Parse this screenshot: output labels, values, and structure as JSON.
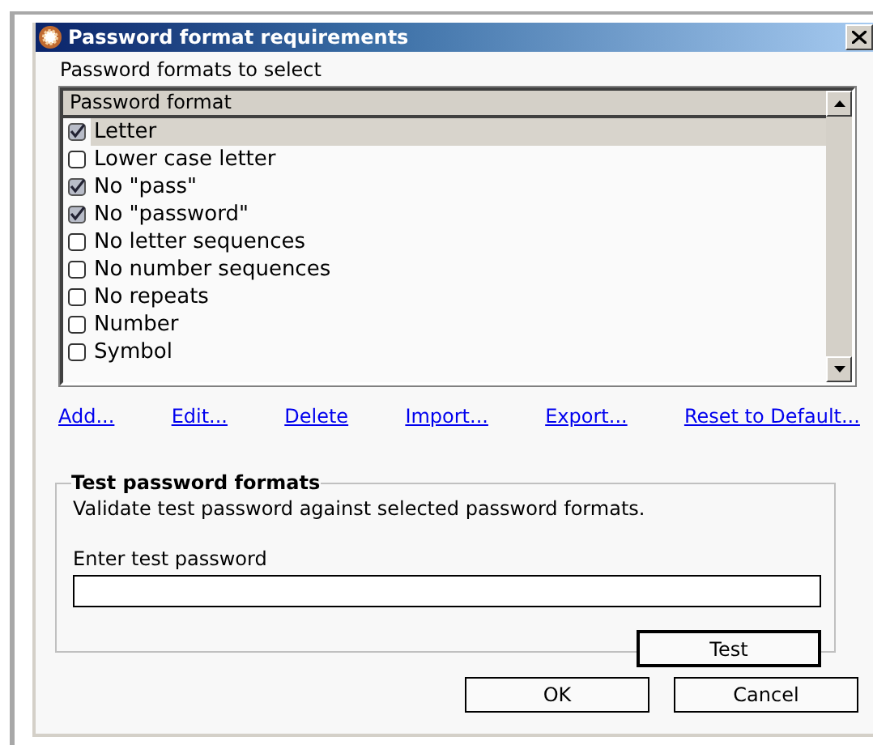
{
  "window": {
    "title": "Password format requirements"
  },
  "list_label": "Password formats to select",
  "table": {
    "columns": [
      "Password format"
    ],
    "rows": [
      {
        "label": "Letter",
        "checked": true,
        "selected": true
      },
      {
        "label": "Lower case letter",
        "checked": false,
        "selected": false
      },
      {
        "label": "No \"pass\"",
        "checked": true,
        "selected": false
      },
      {
        "label": "No \"password\"",
        "checked": true,
        "selected": false
      },
      {
        "label": "No letter sequences",
        "checked": false,
        "selected": false
      },
      {
        "label": "No number sequences",
        "checked": false,
        "selected": false
      },
      {
        "label": "No repeats",
        "checked": false,
        "selected": false
      },
      {
        "label": "Number",
        "checked": false,
        "selected": false
      },
      {
        "label": "Symbol",
        "checked": false,
        "selected": false
      }
    ]
  },
  "links": [
    "Add...",
    "Edit...",
    "Delete",
    "Import...",
    "Export...",
    "Reset to Default..."
  ],
  "test_group": {
    "title": "Test password formats",
    "description": "Validate test password against selected password formats.",
    "field_label": "Enter test password",
    "button": "Test"
  },
  "buttons": [
    "OK",
    "Cancel"
  ]
}
